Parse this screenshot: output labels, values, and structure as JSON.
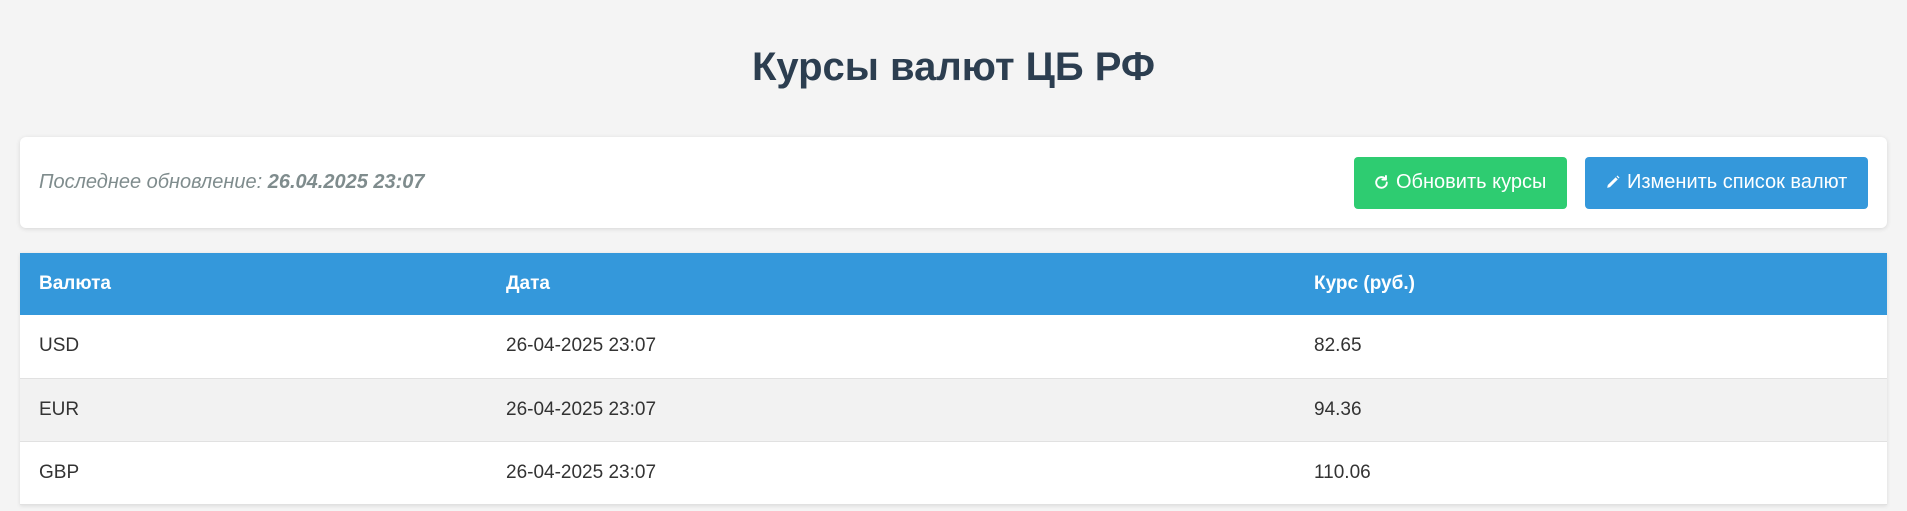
{
  "header": {
    "title": "Курсы валют ЦБ РФ"
  },
  "toolbar": {
    "last_update_label": "Последнее обновление:",
    "last_update_value": "26.04.2025 23:07",
    "refresh_label": "Обновить курсы",
    "edit_label": "Изменить список валют",
    "refresh_icon": "refresh-icon",
    "edit_icon": "pencil-icon"
  },
  "table": {
    "columns": [
      "Валюта",
      "Дата",
      "Курс (руб.)"
    ],
    "rows": [
      {
        "currency": "USD",
        "date": "26-04-2025 23:07",
        "rate": "82.65"
      },
      {
        "currency": "EUR",
        "date": "26-04-2025 23:07",
        "rate": "94.36"
      },
      {
        "currency": "GBP",
        "date": "26-04-2025 23:07",
        "rate": "110.06"
      }
    ]
  },
  "colors": {
    "title": "#2c3e50",
    "refresh_button": "#2ecc71",
    "edit_button": "#3498db",
    "table_header": "#3498db",
    "background": "#f4f4f4"
  }
}
